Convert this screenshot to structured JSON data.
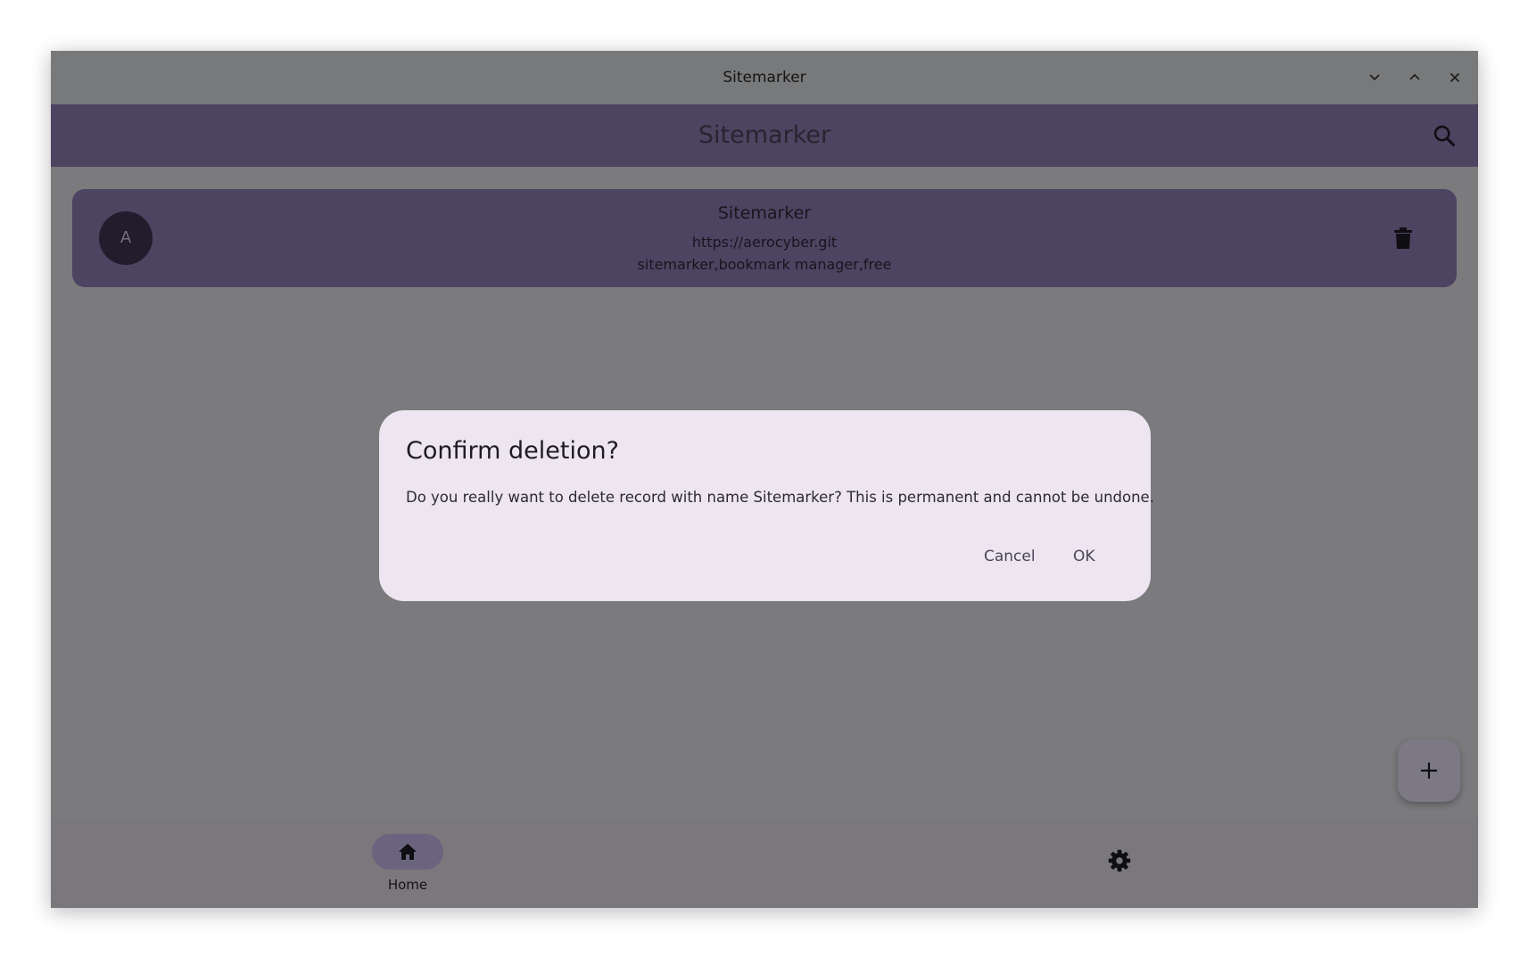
{
  "window": {
    "title": "Sitemarker"
  },
  "appbar": {
    "title": "Sitemarker"
  },
  "record": {
    "avatar_letter": "A",
    "name": "Sitemarker",
    "url": "https://aerocyber.git",
    "tags": "sitemarker,bookmark manager,free"
  },
  "dialog": {
    "title": "Confirm deletion?",
    "message": "Do you really want to delete record with name Sitemarker? This is permanent and cannot be undone.",
    "cancel_label": "Cancel",
    "ok_label": "OK"
  },
  "bottom_nav": {
    "home_label": "Home"
  },
  "colors": {
    "primary": "#8c7fb4",
    "dialog_surface": "#ede6f1",
    "nav_indicator": "#c6b9ea",
    "scrim": "rgba(0,0,0,0.46)"
  }
}
